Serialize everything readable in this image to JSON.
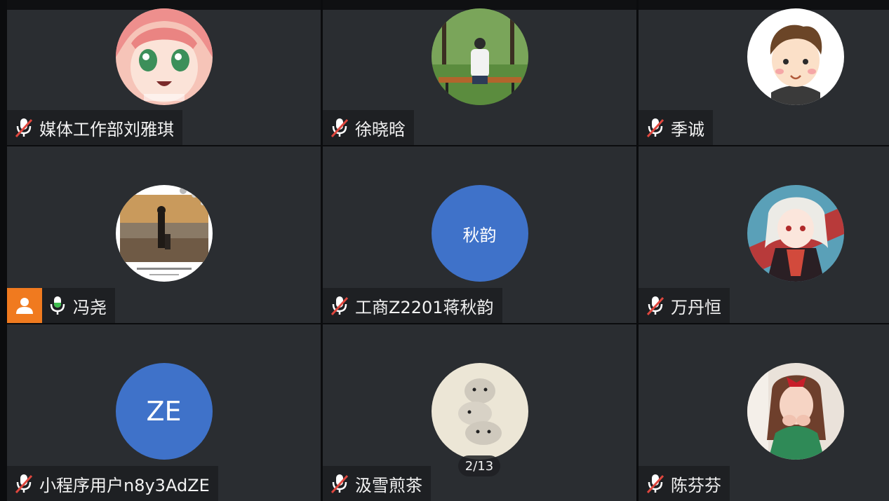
{
  "participants": [
    {
      "name": "媒体工作部刘雅琪",
      "mic": "muted",
      "avatar": "anime-girl-pink"
    },
    {
      "name": "徐晓晗",
      "mic": "muted",
      "avatar": "forest-bench-photo"
    },
    {
      "name": "季诚",
      "mic": "muted",
      "avatar": "cartoon-boy"
    },
    {
      "name": "冯尧",
      "mic": "active",
      "avatar": "beach-sunset-photo",
      "badge": "user-icon"
    },
    {
      "name": "工商Z2201蒋秋韵",
      "mic": "muted",
      "avatar_text": "秋韵",
      "avatar_color": "#3f72c9"
    },
    {
      "name": "万丹恒",
      "mic": "muted",
      "avatar": "anime-character"
    },
    {
      "name": "小程序用户n8y3AdZE",
      "mic": "muted",
      "avatar_text": "ZE",
      "avatar_color": "#3f72c9"
    },
    {
      "name": "汲雪煎茶",
      "mic": "muted",
      "avatar": "hamster-stack"
    },
    {
      "name": "陈芬芬",
      "mic": "muted",
      "avatar": "girl-red-bow-photo"
    }
  ],
  "page_indicator": "2/13",
  "colors": {
    "tile_bg": "#2a2d31",
    "name_bar_bg": "#1e2023",
    "accent_orange": "#f07a1f",
    "avatar_blue": "#3f72c9"
  }
}
